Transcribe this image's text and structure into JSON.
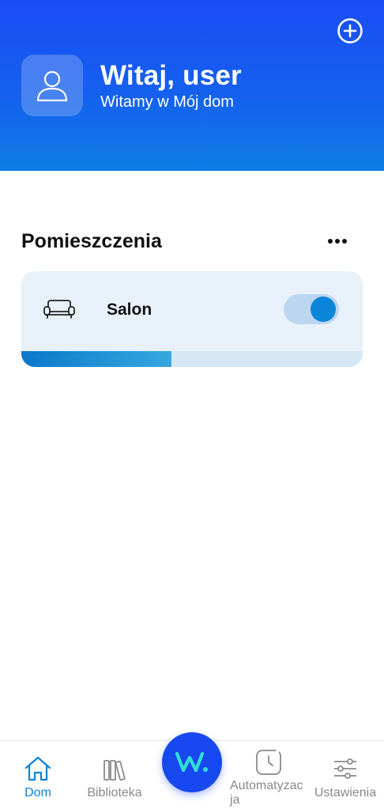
{
  "header": {
    "greeting": "Witaj, user",
    "subtitle": "Witamy w Mój dom",
    "add_icon": "plus-circle-icon",
    "avatar_icon": "user-icon"
  },
  "rooms_section": {
    "title": "Pomieszczenia",
    "more_icon": "more-horizontal-icon",
    "rooms": [
      {
        "name": "Salon",
        "icon": "sofa-icon",
        "toggle_on": true,
        "progress": 0.44
      }
    ]
  },
  "bottom_nav": {
    "items": [
      {
        "label": "Dom",
        "icon": "home-icon",
        "active": true
      },
      {
        "label": "Biblioteka",
        "icon": "library-icon",
        "active": false
      },
      {
        "label": "Automatyzac\nja",
        "icon": "clock-icon",
        "active": false
      },
      {
        "label": "Ustawienia",
        "icon": "sliders-icon",
        "active": false
      }
    ],
    "center_button_icon": "w-logo-icon"
  },
  "colors": {
    "header_blue": "#1a4ef5",
    "accent": "#0a84d8",
    "card_bg": "#e8f1f9",
    "center_button": "#1748f0"
  }
}
